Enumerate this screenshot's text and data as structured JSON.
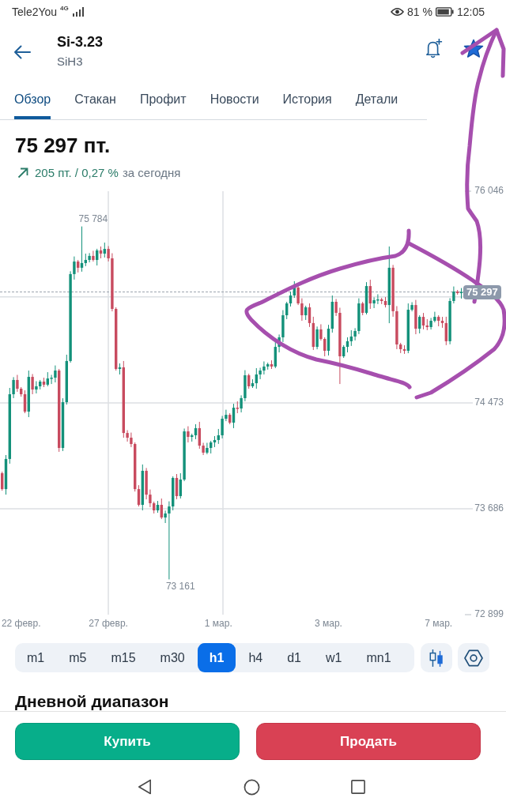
{
  "status_bar": {
    "carrier": "Tele2You",
    "network": "4G",
    "battery": "81 %",
    "time": "12:05"
  },
  "header": {
    "title": "Si-3.23",
    "subtitle": "SiH3",
    "favorite": true
  },
  "tabs": [
    {
      "label": "Обзор",
      "selected": true
    },
    {
      "label": "Стакан",
      "selected": false
    },
    {
      "label": "Профит",
      "selected": false
    },
    {
      "label": "Новости",
      "selected": false
    },
    {
      "label": "История",
      "selected": false
    },
    {
      "label": "Детали",
      "selected": false
    }
  ],
  "quote": {
    "price": "75 297 пт.",
    "rising": true,
    "change": "205 пт. / 0,27 %",
    "period": "за сегодня"
  },
  "chart": {
    "chart_data": {
      "type": "candlestick",
      "categories": [
        null,
        null,
        null,
        null,
        null,
        "22 февр.",
        null,
        null,
        null,
        null,
        null,
        null,
        null,
        null,
        null,
        null,
        null,
        null,
        null,
        null,
        null,
        null,
        null,
        null,
        null,
        null,
        null,
        null,
        "27 февр.",
        null,
        null,
        null,
        null,
        null,
        null,
        null,
        null,
        null,
        null,
        null,
        null,
        null,
        null,
        null,
        null,
        null,
        null,
        null,
        null,
        null,
        null,
        null,
        null,
        null,
        null,
        null,
        null,
        "1 мар.",
        null,
        null,
        null,
        null,
        null,
        null,
        null,
        null,
        null,
        null,
        null,
        null,
        null,
        null,
        null,
        null,
        null,
        null,
        null,
        null,
        null,
        null,
        null,
        null,
        null,
        null,
        null,
        null,
        "3 мар.",
        null,
        null,
        null,
        null,
        null,
        null,
        null,
        null,
        null,
        null,
        null,
        null,
        null,
        null,
        null,
        null,
        null,
        null,
        null,
        null,
        null,
        null,
        null,
        null,
        null,
        null,
        null,
        null,
        "7 мар.",
        null,
        null,
        null,
        null,
        null,
        null
      ],
      "ohlc": [
        [
          73950,
          73962,
          73820,
          73832
        ],
        [
          73832,
          74085,
          73791,
          74056
        ],
        [
          74056,
          74584,
          74021,
          74537
        ],
        [
          74537,
          74664,
          74508,
          74643
        ],
        [
          74643,
          74681,
          74555,
          74578
        ],
        [
          74578,
          74590,
          74519,
          74537
        ],
        [
          74537,
          74566,
          74396,
          74408
        ],
        [
          74408,
          74713,
          74367,
          74666
        ],
        [
          74666,
          74687,
          74537,
          74572
        ],
        [
          74572,
          74634,
          74543,
          74596
        ],
        [
          74596,
          74643,
          74573,
          74631
        ],
        [
          74631,
          74660,
          74590,
          74608
        ],
        [
          74608,
          74701,
          74596,
          74654
        ],
        [
          74654,
          74681,
          74613,
          74660
        ],
        [
          74660,
          74751,
          74625,
          74713
        ],
        [
          74713,
          74725,
          74109,
          74138
        ],
        [
          74138,
          74507,
          74115,
          74478
        ],
        [
          74478,
          74831,
          74460,
          74784
        ],
        [
          74784,
          75451,
          74772,
          75430
        ],
        [
          75430,
          75561,
          75389,
          75523
        ],
        [
          75523,
          75535,
          75442,
          75477
        ],
        [
          75477,
          75784,
          75448,
          75512
        ],
        [
          75512,
          75582,
          75489,
          75535
        ],
        [
          75535,
          75586,
          75517,
          75565
        ],
        [
          75565,
          75603,
          75523,
          75535
        ],
        [
          75535,
          75618,
          75494,
          75606
        ],
        [
          75606,
          75635,
          75547,
          75582
        ],
        [
          75582,
          75664,
          75553,
          75617
        ],
        [
          75617,
          75638,
          75524,
          75547
        ],
        [
          75547,
          75585,
          75153,
          75171
        ],
        [
          75171,
          75183,
          74713,
          74725
        ],
        [
          74725,
          74766,
          74684,
          74737
        ],
        [
          74737,
          74784,
          74214,
          74249
        ],
        [
          74249,
          74270,
          74185,
          74214
        ],
        [
          74214,
          74252,
          74144,
          74167
        ],
        [
          74167,
          74179,
          73814,
          73832
        ],
        [
          73832,
          73861,
          73703,
          73715
        ],
        [
          73715,
          74015,
          73674,
          73968
        ],
        [
          73968,
          73989,
          73756,
          73791
        ],
        [
          73791,
          73829,
          73698,
          73727
        ],
        [
          73727,
          73739,
          73651,
          73674
        ],
        [
          73674,
          73744,
          73656,
          73715
        ],
        [
          73715,
          73762,
          73609,
          73621
        ],
        [
          73621,
          73672,
          73580,
          73651
        ],
        [
          73651,
          73741,
          73161,
          73703
        ],
        [
          73703,
          73927,
          73674,
          73915
        ],
        [
          73915,
          73944,
          73757,
          73780
        ],
        [
          73780,
          73950,
          73762,
          73903
        ],
        [
          73903,
          74282,
          73891,
          74261
        ],
        [
          74261,
          74299,
          74179,
          74220
        ],
        [
          74220,
          74244,
          74185,
          74232
        ],
        [
          74232,
          74314,
          74203,
          74285
        ],
        [
          74285,
          74332,
          74132,
          74155
        ],
        [
          74155,
          74176,
          74085,
          74103
        ],
        [
          74103,
          74176,
          74091,
          74138
        ],
        [
          74138,
          74191,
          74097,
          74179
        ],
        [
          74179,
          74226,
          74144,
          74197
        ],
        [
          74197,
          74279,
          74168,
          74232
        ],
        [
          74232,
          74376,
          74209,
          74355
        ],
        [
          74355,
          74422,
          74337,
          74384
        ],
        [
          74384,
          74396,
          74314,
          74326
        ],
        [
          74326,
          74466,
          74285,
          74437
        ],
        [
          74437,
          74484,
          74396,
          74431
        ],
        [
          74431,
          74529,
          74402,
          74508
        ],
        [
          74508,
          74716,
          74485,
          74678
        ],
        [
          74678,
          74690,
          74578,
          74596
        ],
        [
          74596,
          74648,
          74584,
          74619
        ],
        [
          74619,
          74731,
          74578,
          74684
        ],
        [
          74684,
          74734,
          74649,
          74713
        ],
        [
          74713,
          74781,
          74684,
          74743
        ],
        [
          74743,
          74772,
          74720,
          74760
        ],
        [
          74760,
          74789,
          74725,
          74743
        ],
        [
          74743,
          74936,
          74731,
          74889
        ],
        [
          74889,
          74981,
          74848,
          74960
        ],
        [
          74960,
          75162,
          74925,
          75124
        ],
        [
          75124,
          75224,
          75095,
          75212
        ],
        [
          75212,
          75300,
          75189,
          75271
        ],
        [
          75271,
          75377,
          75253,
          75330
        ],
        [
          75330,
          75351,
          75200,
          75212
        ],
        [
          75212,
          75250,
          75083,
          75124
        ],
        [
          75124,
          75195,
          75089,
          75183
        ],
        [
          75183,
          75212,
          75037,
          75066
        ],
        [
          75066,
          75113,
          74866,
          74889
        ],
        [
          74889,
          75040,
          74871,
          75019
        ],
        [
          75019,
          75057,
          74936,
          74948
        ],
        [
          74948,
          74960,
          74819,
          74860
        ],
        [
          74860,
          75053,
          74825,
          75024
        ],
        [
          75024,
          75271,
          74995,
          75224
        ],
        [
          75224,
          75245,
          75119,
          75142
        ],
        [
          75142,
          75180,
          74613,
          74819
        ],
        [
          74819,
          74901,
          74807,
          74889
        ],
        [
          74889,
          74960,
          74848,
          74931
        ],
        [
          74931,
          75013,
          74896,
          74966
        ],
        [
          74966,
          75028,
          74937,
          75007
        ],
        [
          75007,
          75250,
          74984,
          75212
        ],
        [
          75212,
          75224,
          75124,
          75142
        ],
        [
          75142,
          75370,
          75130,
          75341
        ],
        [
          75341,
          75388,
          75171,
          75212
        ],
        [
          75212,
          75257,
          75177,
          75236
        ],
        [
          75236,
          75280,
          75207,
          75242
        ],
        [
          75242,
          75254,
          75207,
          75230
        ],
        [
          75230,
          75259,
          75182,
          75200
        ],
        [
          75200,
          75635,
          75065,
          75477
        ],
        [
          75477,
          75498,
          75113,
          75154
        ],
        [
          75154,
          75192,
          74872,
          74907
        ],
        [
          74907,
          74919,
          74843,
          74872
        ],
        [
          74872,
          74901,
          74837,
          74860
        ],
        [
          74860,
          75212,
          74842,
          75165
        ],
        [
          75165,
          75221,
          75153,
          75200
        ],
        [
          75200,
          75238,
          74983,
          75024
        ],
        [
          75024,
          75124,
          74989,
          75112
        ],
        [
          75112,
          75141,
          75019,
          75048
        ],
        [
          75048,
          75095,
          75013,
          75036
        ],
        [
          75036,
          75104,
          75018,
          75083
        ],
        [
          75083,
          75150,
          75071,
          75112
        ],
        [
          75112,
          75124,
          75042,
          75083
        ],
        [
          75083,
          75112,
          75031,
          75066
        ],
        [
          75066,
          75113,
          74902,
          74931
        ],
        [
          74931,
          75251,
          74908,
          75230
        ],
        [
          75230,
          75338,
          75212,
          75300
        ],
        [
          75300,
          75312,
          75277,
          75289
        ],
        [
          75289,
          75326,
          75248,
          75297
        ]
      ],
      "ylim": [
        72899,
        76046
      ],
      "yticks": [
        {
          "value": 76046,
          "label": "76 046"
        },
        {
          "value": 74473,
          "label": "74 473"
        },
        {
          "value": 73686,
          "label": "73 686"
        },
        {
          "value": 72899,
          "label": "72 899"
        }
      ],
      "annotations": [
        "75 784",
        "73 161"
      ],
      "ref_lines": [
        {
          "axis": "y",
          "value": 75297,
          "label": "75 297"
        }
      ]
    }
  },
  "timeframes": [
    {
      "label": "m1",
      "selected": false
    },
    {
      "label": "m5",
      "selected": false
    },
    {
      "label": "m15",
      "selected": false
    },
    {
      "label": "m30",
      "selected": false
    },
    {
      "label": "h1",
      "selected": true
    },
    {
      "label": "h4",
      "selected": false
    },
    {
      "label": "d1",
      "selected": false
    },
    {
      "label": "w1",
      "selected": false
    },
    {
      "label": "mn1",
      "selected": false
    }
  ],
  "section_title": "Дневной диапазон",
  "actions": [
    {
      "label": "Купить",
      "kind": "buy"
    },
    {
      "label": "Продать",
      "kind": "sell"
    }
  ]
}
